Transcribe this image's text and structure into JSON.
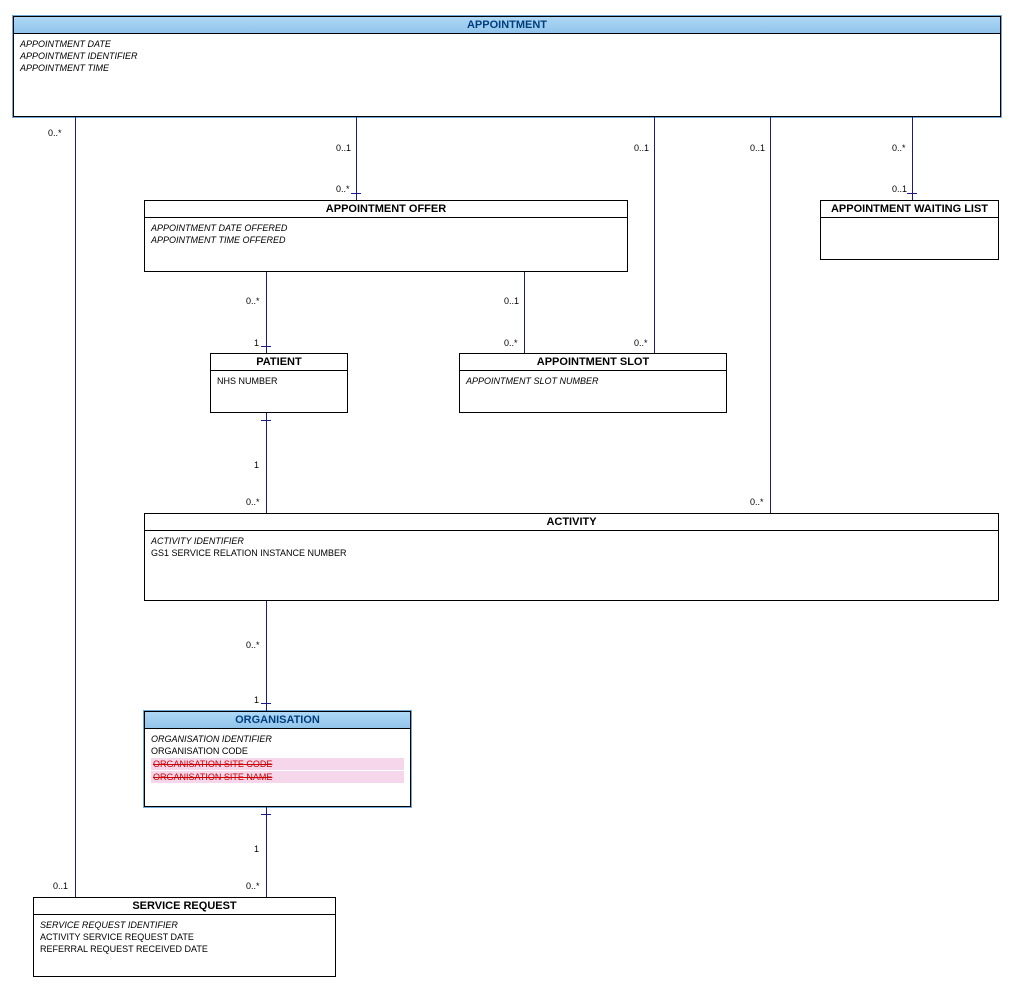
{
  "entities": {
    "appointment": {
      "title": "APPOINTMENT",
      "attrs": [
        "APPOINTMENT DATE",
        "APPOINTMENT IDENTIFIER",
        "APPOINTMENT TIME"
      ]
    },
    "appointment_offer": {
      "title": "APPOINTMENT OFFER",
      "attrs": [
        "APPOINTMENT DATE OFFERED",
        "APPOINTMENT TIME OFFERED"
      ]
    },
    "appointment_waiting_list": {
      "title": "APPOINTMENT WAITING LIST",
      "attrs": []
    },
    "patient": {
      "title": "PATIENT",
      "attrs": [
        "NHS NUMBER"
      ]
    },
    "appointment_slot": {
      "title": "APPOINTMENT SLOT",
      "attrs": [
        "APPOINTMENT SLOT NUMBER"
      ]
    },
    "activity": {
      "title": "ACTIVITY",
      "attrs": [
        "ACTIVITY IDENTIFIER",
        "GS1 SERVICE RELATION INSTANCE NUMBER"
      ]
    },
    "organisation": {
      "title": "ORGANISATION",
      "attrs": [
        "ORGANISATION IDENTIFIER",
        "ORGANISATION CODE",
        "ORGANISATION SITE CODE",
        "ORGANISATION SITE NAME"
      ]
    },
    "service_request": {
      "title": "SERVICE REQUEST",
      "attrs": [
        "SERVICE REQUEST IDENTIFIER",
        "ACTIVITY SERVICE REQUEST DATE",
        "REFERRAL REQUEST RECEIVED DATE"
      ]
    }
  },
  "multiplicities": {
    "m_app_left": "0..*",
    "m_app_offer_top": "0..1",
    "m_app_slot_top": "0..1",
    "m_app_act_top": "0..1",
    "m_app_wait_top": "0..*",
    "m_offer_top": "0..*",
    "m_wait_top": "0..1",
    "m_offer_pat_bottom": "0..*",
    "m_offer_slot_bottom": "0..1",
    "m_pat_top": "1",
    "m_slot_top_left": "0..*",
    "m_slot_top_right": "0..*",
    "m_pat_bottom": "1",
    "m_activity_top": "0..*",
    "m_activity_top_right": "0..*",
    "m_activity_bottom": "0..*",
    "m_org_top": "1",
    "m_org_bottom": "1",
    "m_sr_top": "0..*",
    "m_sr_left": "0..1"
  }
}
